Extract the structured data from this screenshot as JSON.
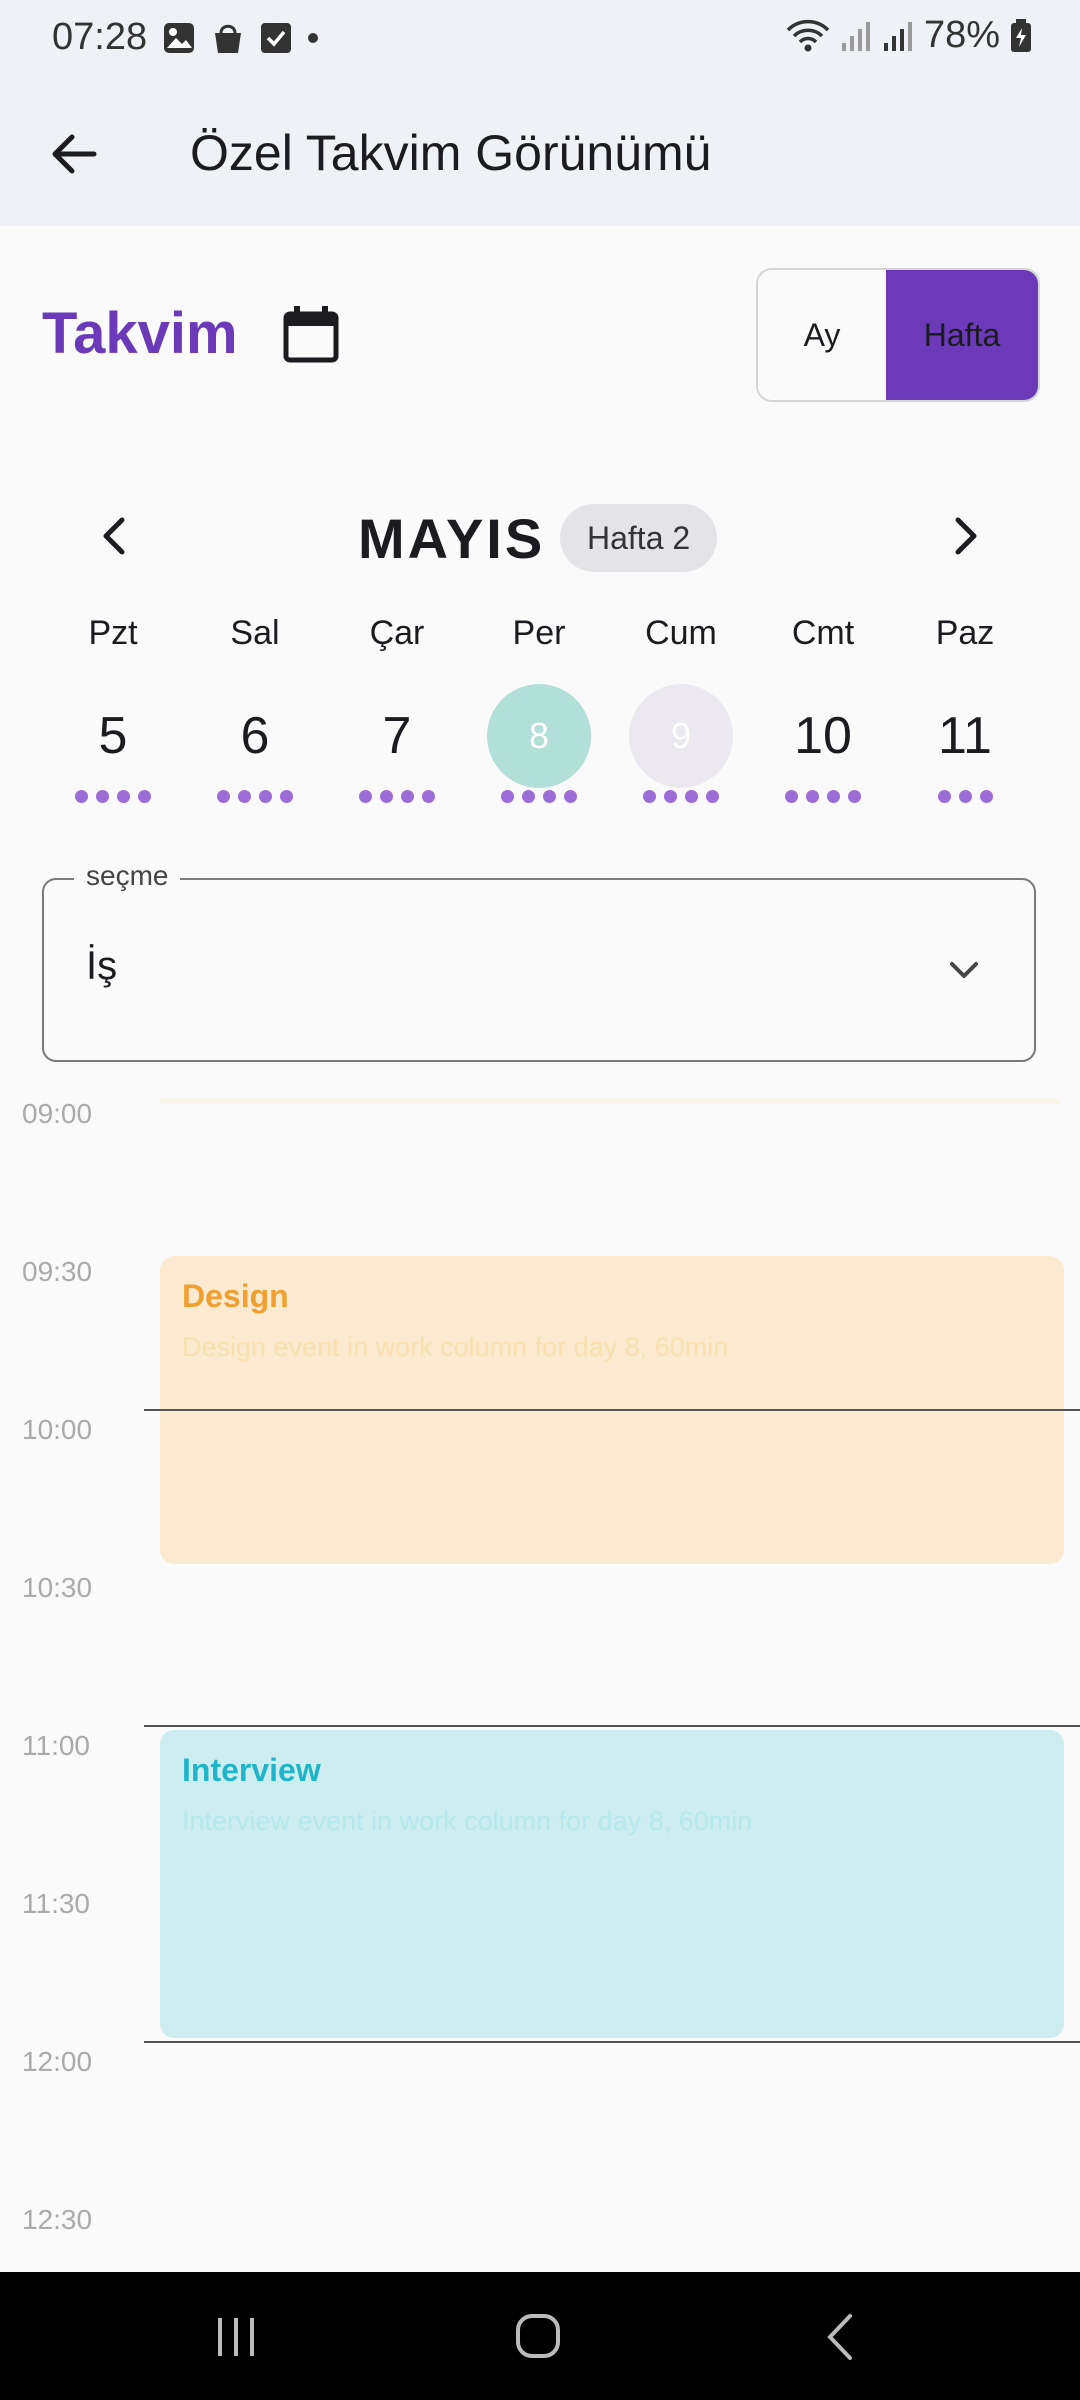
{
  "status_bar": {
    "time": "07:28",
    "battery": "78%"
  },
  "app_bar": {
    "title": "Özel Takvim Görünümü"
  },
  "header": {
    "title": "Takvim",
    "view_toggle": {
      "month_label": "Ay",
      "week_label": "Hafta",
      "selected": "Hafta"
    }
  },
  "calendar": {
    "month": "MAYIS",
    "week_badge": "Hafta 2",
    "days": [
      {
        "name": "Pzt",
        "number": "5",
        "dots": 4,
        "state": "normal"
      },
      {
        "name": "Sal",
        "number": "6",
        "dots": 4,
        "state": "normal"
      },
      {
        "name": "Çar",
        "number": "7",
        "dots": 4,
        "state": "normal"
      },
      {
        "name": "Per",
        "number": "8",
        "dots": 4,
        "state": "selected"
      },
      {
        "name": "Cum",
        "number": "9",
        "dots": 4,
        "state": "today"
      },
      {
        "name": "Cmt",
        "number": "10",
        "dots": 4,
        "state": "normal"
      },
      {
        "name": "Paz",
        "number": "11",
        "dots": 3,
        "state": "normal"
      }
    ]
  },
  "select": {
    "label": "seçme",
    "value": "İş"
  },
  "timeline": {
    "times": [
      "09:00",
      "09:30",
      "10:00",
      "10:30",
      "11:00",
      "11:30",
      "12:00",
      "12:30"
    ],
    "events": [
      {
        "title": "Design",
        "description": "Design event in work column for day 8, 60min",
        "title_color": "#f0a030",
        "desc_color": "#f9e0b0",
        "bg": "#fbe9d0"
      },
      {
        "title": "Interview",
        "description": "Interview event in work column for day 8, 60min",
        "title_color": "#1fb5c8",
        "desc_color": "#b6e8ee",
        "bg": "#cdedf1"
      }
    ]
  },
  "colors": {
    "accent": "#6a3ab8",
    "dot": "#9c6dd6"
  }
}
